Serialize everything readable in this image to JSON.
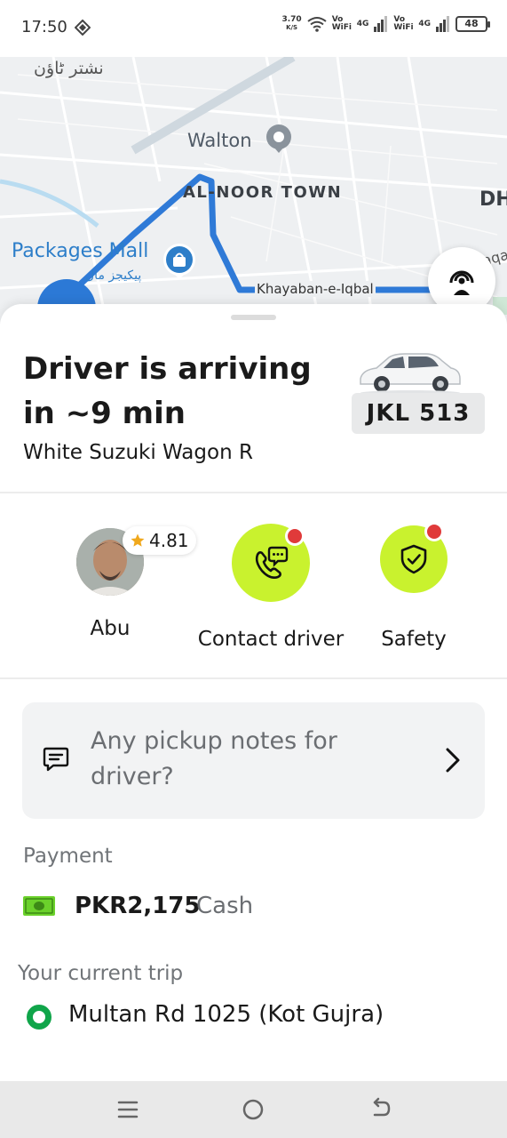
{
  "status_bar": {
    "time": "17:50",
    "net_speed_value": "3.70",
    "net_speed_unit": "K/S",
    "wifi_tag": "Vo WiFi",
    "signal_tag": "4G",
    "battery": "48"
  },
  "map": {
    "label_urdu_top": "نشتر ٹاؤن",
    "label_walton": "Walton",
    "label_al_noor": "AL-NOOR TOWN",
    "label_packages": "Packages Mall",
    "label_packages_urdu": "پیکیجز مال",
    "label_khayaban": "Khayaban-e-Iqbal",
    "label_liaqat": "Liaqa",
    "label_dh": "DH",
    "route_color": "#2f7ad7"
  },
  "trip_status": {
    "title": "Driver is arriving in ~9 min",
    "vehicle": "White Suzuki Wagon R",
    "plate": "JKL 513"
  },
  "driver": {
    "name": "Abu",
    "rating": "4.81"
  },
  "actions": {
    "contact_label": "Contact driver",
    "safety_label": "Safety",
    "accent": "#c9f22e"
  },
  "notes": {
    "placeholder": "Any pickup notes for driver?"
  },
  "payment": {
    "heading": "Payment",
    "amount": "PKR2,175",
    "method": "Cash"
  },
  "trip": {
    "heading": "Your current trip",
    "pickup": "Multan Rd 1025 (Kot Gujra)"
  },
  "icons": [
    "diamond-nav-icon",
    "wifi-icon",
    "signal-icon",
    "battery-icon",
    "location-pin-icon",
    "shopping-bag-icon",
    "listen-icon",
    "car-icon",
    "star-icon",
    "phone-chat-icon",
    "shield-check-icon",
    "message-icon",
    "chevron-right-icon",
    "cash-icon",
    "menu-icon",
    "home-icon",
    "back-icon"
  ]
}
